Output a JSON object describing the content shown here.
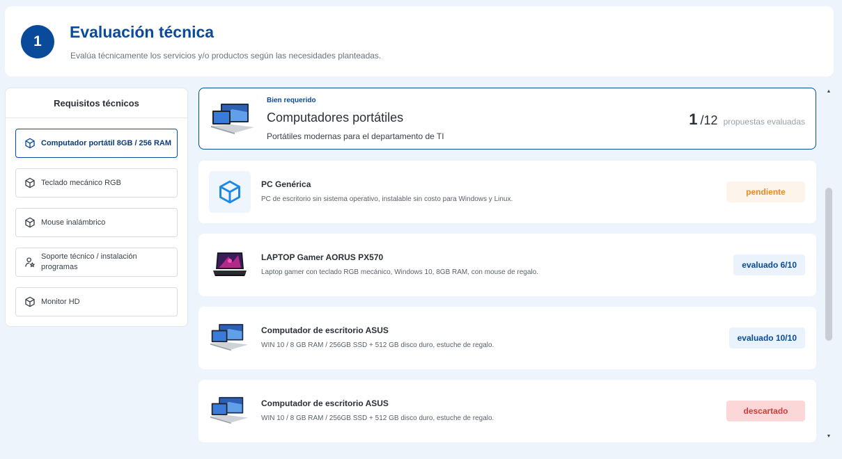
{
  "header": {
    "step": "1",
    "title": "Evaluación técnica",
    "subtitle": "Evalúa técnicamente los servicios y/o productos según las necesidades planteadas."
  },
  "requirements": {
    "title": "Requisitos técnicos",
    "items": [
      {
        "label": "Computador portátil 8GB / 256 RAM",
        "icon": "cube-icon",
        "active": true
      },
      {
        "label": "Teclado mecánico RGB",
        "icon": "cube-icon",
        "active": false
      },
      {
        "label": "Mouse inalámbrico",
        "icon": "cube-icon",
        "active": false
      },
      {
        "label": "Soporte técnico / instalación programas",
        "icon": "person-star-icon",
        "active": false
      },
      {
        "label": "Monitor HD",
        "icon": "cube-icon",
        "active": false
      }
    ]
  },
  "main_item": {
    "tag": "Bien requerido",
    "name": "Computadores portátiles",
    "description": "Portátiles modernas para el departamento de TI",
    "evaluated": "1",
    "total": "/12",
    "evaluated_label": "propuestas evaluadas"
  },
  "proposals": [
    {
      "name": "PC Genérica",
      "description": "PC de escritorio sin sistema operativo, instalable sin costo para Windows y Linux.",
      "status": "pendiente",
      "image": "cube-icon"
    },
    {
      "name": "LAPTOP Gamer AORUS PX570",
      "description": "Laptop gamer con teclado RGB mecánico, Windows 10, 8GB RAM, con mouse de regalo.",
      "status": "evaluado 6/10",
      "image": "gaming-laptop-image"
    },
    {
      "name": "Computador de escritorio ASUS",
      "description": "WIN 10 / 8 GB RAM / 256GB SSD + 512 GB disco duro, estuche de regalo.",
      "status": "evaluado 10/10",
      "image": "laptop-image"
    },
    {
      "name": "Computador de escritorio ASUS",
      "description": "WIN 10 / 8 GB RAM / 256GB SSD + 512 GB disco duro, estuche de regalo.",
      "status": "descartado",
      "image": "laptop-image"
    }
  ],
  "colors": {
    "primary": "#0a4a9a",
    "pending": "#e58a2a",
    "discarded": "#d83a3a",
    "background": "#eef4fb"
  }
}
